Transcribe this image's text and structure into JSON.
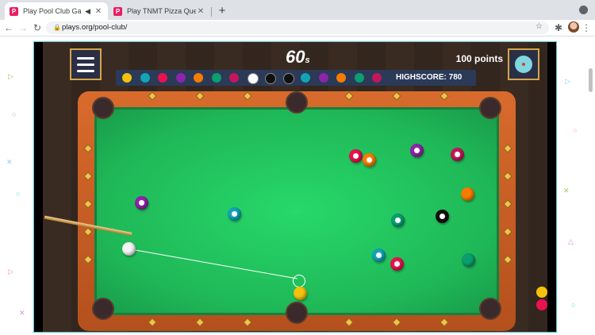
{
  "browser": {
    "tabs": [
      {
        "title": "Play Pool Club Game: F",
        "active": true
      },
      {
        "title": "Play TNMT Pizza Quest Gam",
        "active": false
      }
    ],
    "url": "plays.org/pool-club/"
  },
  "game": {
    "timer_value": "60",
    "timer_unit": "s",
    "points": "100 points",
    "highscore": "HIGHSCORE: 780",
    "remaining_balls_colors": [
      "#f4c20d",
      "#12a4b5",
      "#e8124f",
      "#8e24aa",
      "#f57c00",
      "#0b9e6e",
      "#c2185b",
      "#ffffff",
      "#111111",
      "#111111",
      "#12a4b5",
      "#8e24aa",
      "#f57c00",
      "#0b9e6e",
      "#c2185b"
    ],
    "table_balls": [
      {
        "color": "#8e24aa",
        "stripe": true
      },
      {
        "color": "#12a4b5",
        "stripe": true
      },
      {
        "color": "#f4f4f4",
        "stripe": false
      },
      {
        "color": "#e8124f",
        "stripe": true
      },
      {
        "color": "#f57c00",
        "stripe": true
      },
      {
        "color": "#8e24aa",
        "stripe": true
      },
      {
        "color": "#c2185b",
        "stripe": true
      },
      {
        "color": "#f57c00",
        "stripe": false
      },
      {
        "color": "#0b9e6e",
        "stripe": true
      },
      {
        "color": "#111111",
        "stripe": true
      },
      {
        "color": "#12a4b5",
        "stripe": true
      },
      {
        "color": "#e8124f",
        "stripe": true
      },
      {
        "color": "#0b9e6e",
        "stripe": false
      },
      {
        "color": "#f4c20d",
        "stripe": false
      }
    ],
    "colors": {
      "felt": "#1fb757",
      "rail": "#c85d24",
      "hud_panel": "#2b3a57"
    }
  }
}
